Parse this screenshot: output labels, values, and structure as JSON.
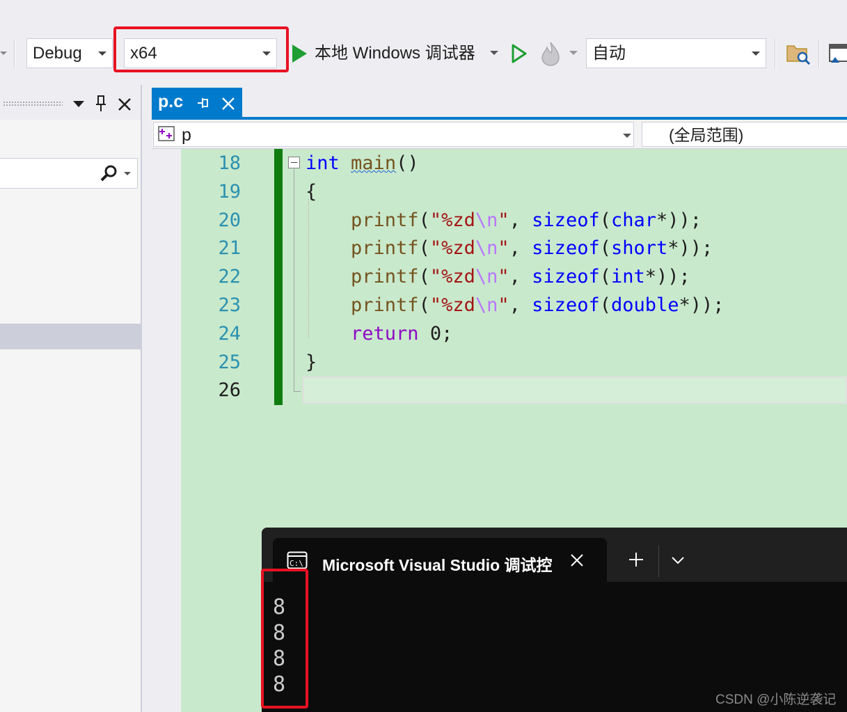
{
  "toolbar": {
    "configuration": "Debug",
    "platform": "x64",
    "debugger_label": "本地 Windows 调试器",
    "solution_config": "自动",
    "colors": {
      "play_green": "#1e9e33",
      "highlight_red": "#e81123"
    },
    "icons": [
      "start-debugging-icon",
      "start-without-debugging-icon",
      "hot-reload-icon",
      "open-folder-icon",
      "window-layout-icon"
    ]
  },
  "left_panel": {
    "icons": [
      "dropdown-icon",
      "pin-icon",
      "close-icon",
      "search-icon"
    ]
  },
  "editor": {
    "tab": {
      "label": "p.c"
    },
    "navbar": {
      "scope_left": "p",
      "scope_right": "(全局范围)"
    },
    "lines": [
      {
        "num": "18",
        "segments": [
          {
            "t": "int",
            "c": "kw"
          },
          {
            "t": " "
          },
          {
            "t": "main",
            "c": "fn squig"
          },
          {
            "t": "()"
          }
        ]
      },
      {
        "num": "19",
        "segments": [
          {
            "t": "{"
          }
        ]
      },
      {
        "num": "20",
        "segments": [
          {
            "t": "    "
          },
          {
            "t": "printf",
            "c": "fn"
          },
          {
            "t": "("
          },
          {
            "t": "\"%zd",
            "c": "str"
          },
          {
            "t": "\\n",
            "c": "esc"
          },
          {
            "t": "\"",
            "c": "str"
          },
          {
            "t": ", "
          },
          {
            "t": "sizeof",
            "c": "kw"
          },
          {
            "t": "("
          },
          {
            "t": "char",
            "c": "kw"
          },
          {
            "t": "*));"
          }
        ]
      },
      {
        "num": "21",
        "segments": [
          {
            "t": "    "
          },
          {
            "t": "printf",
            "c": "fn"
          },
          {
            "t": "("
          },
          {
            "t": "\"%zd",
            "c": "str"
          },
          {
            "t": "\\n",
            "c": "esc"
          },
          {
            "t": "\"",
            "c": "str"
          },
          {
            "t": ", "
          },
          {
            "t": "sizeof",
            "c": "kw"
          },
          {
            "t": "("
          },
          {
            "t": "short",
            "c": "kw"
          },
          {
            "t": "*));"
          }
        ]
      },
      {
        "num": "22",
        "segments": [
          {
            "t": "    "
          },
          {
            "t": "printf",
            "c": "fn"
          },
          {
            "t": "("
          },
          {
            "t": "\"%zd",
            "c": "str"
          },
          {
            "t": "\\n",
            "c": "esc"
          },
          {
            "t": "\"",
            "c": "str"
          },
          {
            "t": ", "
          },
          {
            "t": "sizeof",
            "c": "kw"
          },
          {
            "t": "("
          },
          {
            "t": "int",
            "c": "kw"
          },
          {
            "t": "*));"
          }
        ]
      },
      {
        "num": "23",
        "segments": [
          {
            "t": "    "
          },
          {
            "t": "printf",
            "c": "fn"
          },
          {
            "t": "("
          },
          {
            "t": "\"%zd",
            "c": "str"
          },
          {
            "t": "\\n",
            "c": "esc"
          },
          {
            "t": "\"",
            "c": "str"
          },
          {
            "t": ", "
          },
          {
            "t": "sizeof",
            "c": "kw"
          },
          {
            "t": "("
          },
          {
            "t": "double",
            "c": "kw"
          },
          {
            "t": "*));"
          }
        ]
      },
      {
        "num": "24",
        "segments": [
          {
            "t": "    "
          },
          {
            "t": "return",
            "c": "ret"
          },
          {
            "t": " 0;"
          }
        ]
      },
      {
        "num": "25",
        "segments": [
          {
            "t": "}"
          }
        ]
      },
      {
        "num": "26",
        "segments": []
      }
    ],
    "colors": {
      "background": "#c9e9cc",
      "change_bar": "#107c10",
      "keyword": "#0000ff",
      "function": "#74531f",
      "string": "#a31515",
      "line_number": "#2b91af"
    }
  },
  "terminal": {
    "tab_title": "Microsoft Visual Studio 调试控制台",
    "output": [
      "8",
      "8",
      "8",
      "8"
    ],
    "icons": [
      "console-icon",
      "close-icon",
      "new-tab-icon",
      "chevron-down-icon"
    ]
  },
  "watermark": "CSDN @小陈逆袭记"
}
